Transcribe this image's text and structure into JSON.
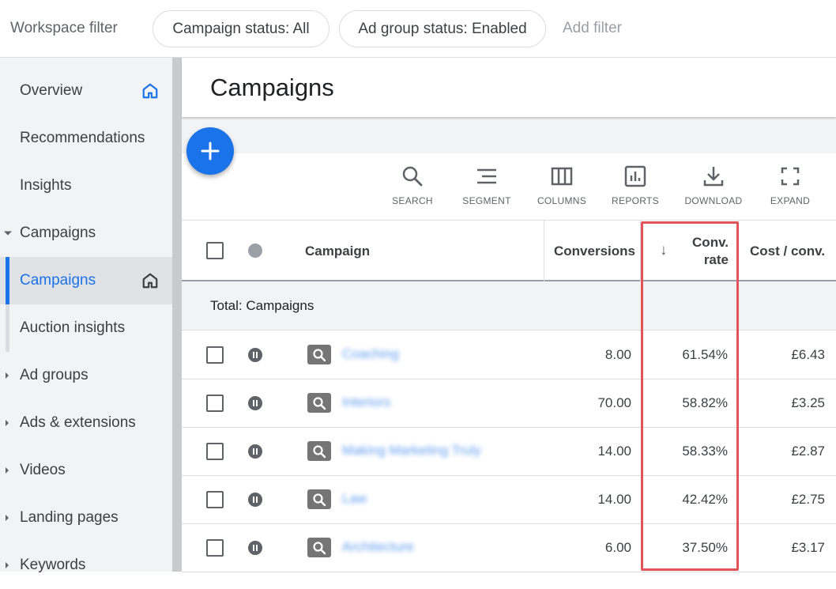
{
  "filter_bar": {
    "title": "Workspace filter",
    "chips": [
      "Campaign status: All",
      "Ad group status: Enabled"
    ],
    "add_filter": "Add filter"
  },
  "sidebar": {
    "items": [
      {
        "label": "Overview",
        "icon": "home-icon"
      },
      {
        "label": "Recommendations"
      },
      {
        "label": "Insights"
      },
      {
        "label": "Campaigns",
        "expanded": true
      },
      {
        "label": "Campaigns",
        "active": true,
        "icon": "home-icon"
      },
      {
        "label": "Auction insights"
      },
      {
        "label": "Ad groups"
      },
      {
        "label": "Ads & extensions"
      },
      {
        "label": "Videos"
      },
      {
        "label": "Landing pages"
      },
      {
        "label": "Keywords"
      }
    ]
  },
  "page": {
    "title": "Campaigns"
  },
  "toolbar": {
    "search": "SEARCH",
    "segment": "SEGMENT",
    "columns": "COLUMNS",
    "reports": "REPORTS",
    "download": "DOWNLOAD",
    "expand": "EXPAND"
  },
  "table": {
    "headers": {
      "campaign": "Campaign",
      "conversions": "Conversions",
      "conv_rate_line1": "Conv.",
      "conv_rate_line2": "rate",
      "cost_conv": "Cost / conv."
    },
    "sort_indicator": "↓",
    "total_label": "Total: Campaigns",
    "rows": [
      {
        "name": "Coaching",
        "conversions": "8.00",
        "conv_rate": "61.54%",
        "cost_conv": "£6.43"
      },
      {
        "name": "Interiors",
        "conversions": "70.00",
        "conv_rate": "58.82%",
        "cost_conv": "£3.25"
      },
      {
        "name": "Making Marketing Truly",
        "conversions": "14.00",
        "conv_rate": "58.33%",
        "cost_conv": "£2.87"
      },
      {
        "name": "Law",
        "conversions": "14.00",
        "conv_rate": "42.42%",
        "cost_conv": "£2.75"
      },
      {
        "name": "Architecture",
        "conversions": "6.00",
        "conv_rate": "37.50%",
        "cost_conv": "£3.17"
      }
    ]
  },
  "colors": {
    "accent": "#1a73e8",
    "highlight": "#e0545a",
    "sidebar_bg": "#f1f3f4"
  }
}
